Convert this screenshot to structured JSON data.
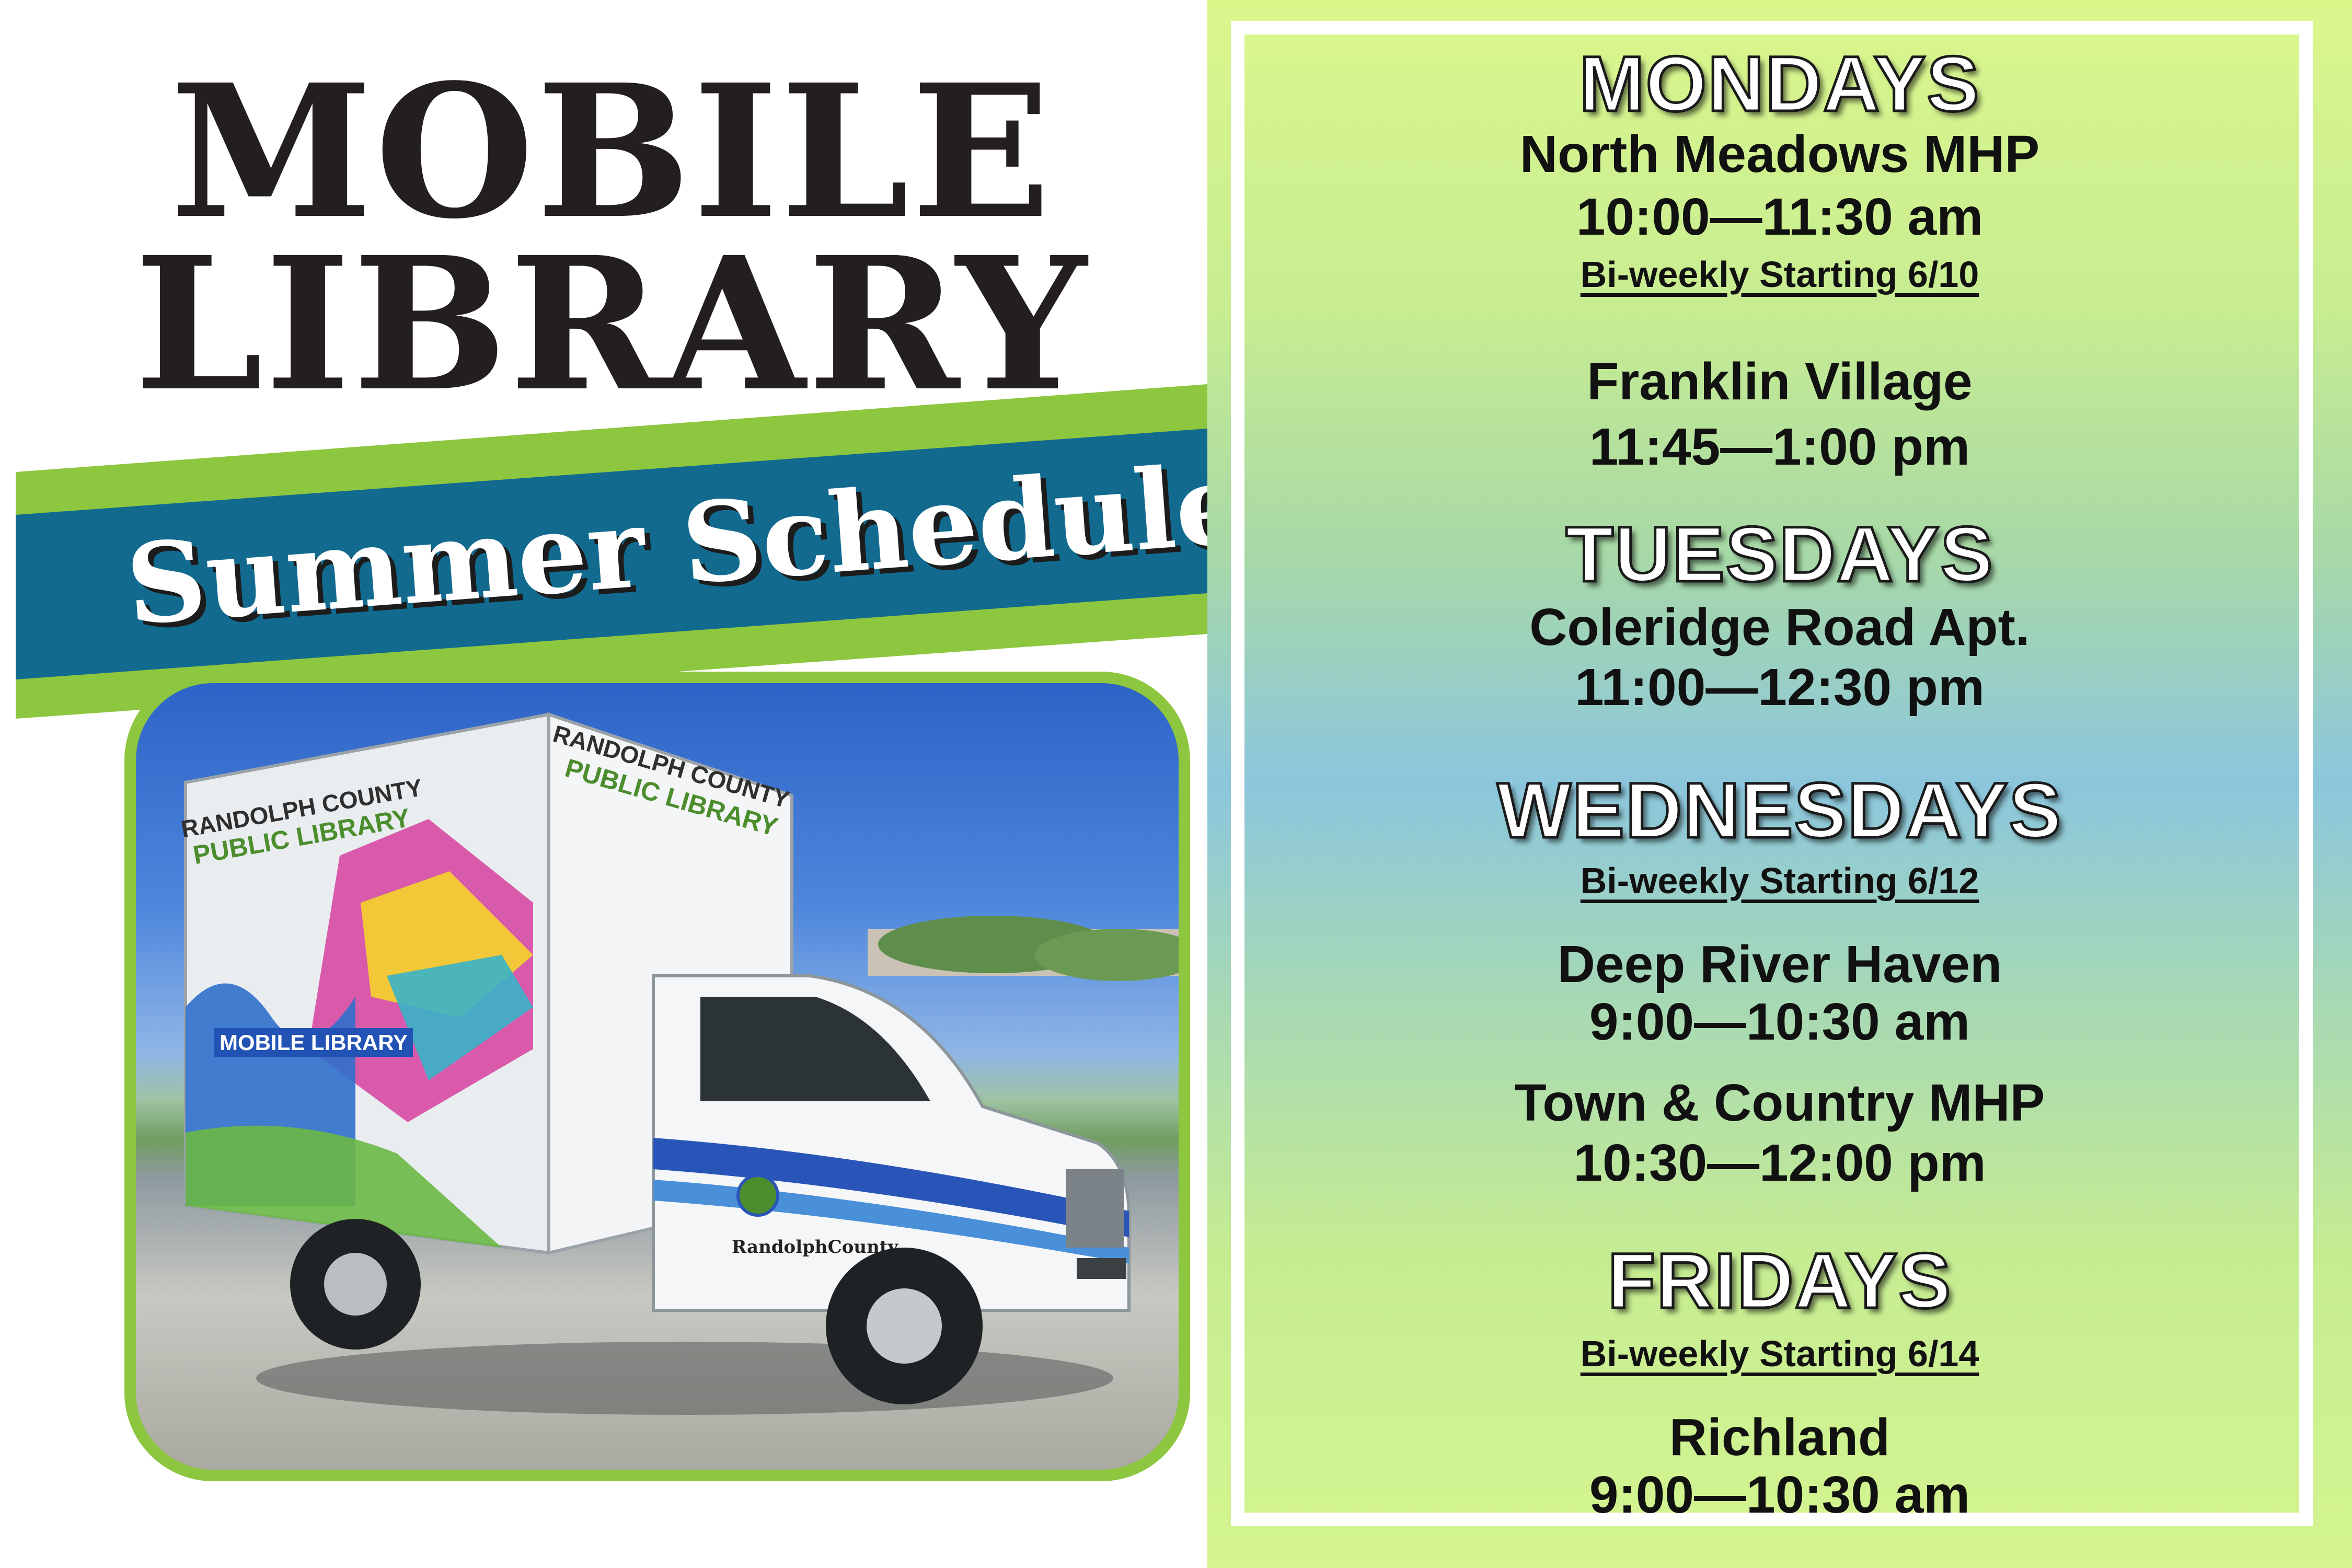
{
  "poster": {
    "title_line_1": "MOBILE",
    "title_line_2": "LIBRARY",
    "banner_text": "Summer Schedule"
  },
  "photo": {
    "truck_box_text_1": "RANDOLPH COUNTY",
    "truck_box_text_2": "PUBLIC LIBRARY",
    "truck_side_text_1": "RANDOLPH COUNTY",
    "truck_side_text_2": "PUBLIC LIBRARY",
    "truck_mobile_text": "MOBILE LIBRARY",
    "truck_door_text": "RandolphCounty"
  },
  "schedule": {
    "mondays": {
      "day": "MONDAYS",
      "stop_1_location": "North Meadows MHP",
      "stop_1_time": "10:00—11:30 am",
      "stop_1_note": "Bi-weekly Starting 6/10",
      "stop_2_location": "Franklin Village",
      "stop_2_time": "11:45—1:00 pm"
    },
    "tuesdays": {
      "day": "TUESDAYS",
      "stop_1_location": "Coleridge Road Apt.",
      "stop_1_time": "11:00—12:30 pm"
    },
    "wednesdays": {
      "day": "WEDNESDAYS",
      "note": "Bi-weekly Starting 6/12",
      "stop_1_location": "Deep River Haven",
      "stop_1_time": "9:00—10:30 am",
      "stop_2_location": "Town & Country MHP",
      "stop_2_time": "10:30—12:00 pm"
    },
    "fridays": {
      "day": "FRIDAYS",
      "note": "Bi-weekly Starting 6/14",
      "stop_1_location": "Richland",
      "stop_1_time": "9:00—10:30 am"
    }
  },
  "colors": {
    "banner_green": "#8dc63f",
    "banner_blue": "#136a8f",
    "title_black": "#231f20"
  }
}
